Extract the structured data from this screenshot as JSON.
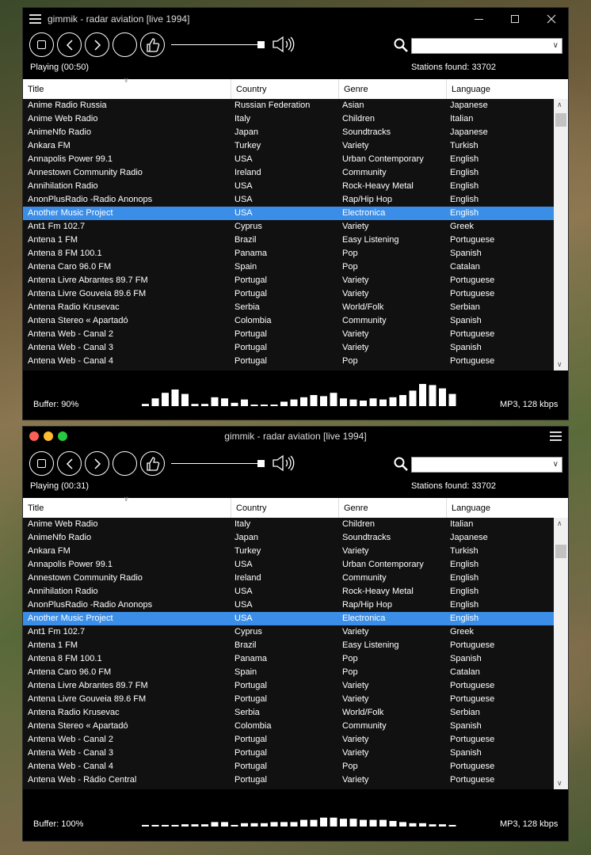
{
  "windows": [
    {
      "title": "gimmik - radar aviation [live 1994]",
      "status": "Playing (00:50)",
      "stations_found": "Stations found: 33702",
      "search_value": "",
      "columns": [
        "Title",
        "Country",
        "Genre",
        "Language"
      ],
      "rows": [
        [
          "Anime Radio Russia",
          "Russian Federation",
          "Asian",
          "Japanese"
        ],
        [
          "Anime Web Radio",
          "Italy",
          "Children",
          "Italian"
        ],
        [
          "AnimeNfo Radio",
          "Japan",
          "Soundtracks",
          "Japanese"
        ],
        [
          "Ankara FM",
          "Turkey",
          "Variety",
          "Turkish"
        ],
        [
          "Annapolis Power 99.1",
          "USA",
          "Urban Contemporary",
          "English"
        ],
        [
          "Annestown Community Radio",
          "Ireland",
          "Community",
          "English"
        ],
        [
          "Annihilation Radio",
          "USA",
          "Rock-Heavy Metal",
          "English"
        ],
        [
          "AnonPlusRadio -Radio Anonops",
          "USA",
          "Rap/Hip Hop",
          "English"
        ],
        [
          "Another Music Project",
          "USA",
          "Electronica",
          "English"
        ],
        [
          "Ant1 Fm 102.7",
          "Cyprus",
          "Variety",
          "Greek"
        ],
        [
          "Antena 1 FM",
          "Brazil",
          "Easy Listening",
          "Portuguese"
        ],
        [
          "Antena 8 FM 100.1",
          "Panama",
          "Pop",
          "Spanish"
        ],
        [
          "Antena Caro 96.0 FM",
          "Spain",
          "Pop",
          "Catalan"
        ],
        [
          "Antena Livre Abrantes 89.7 FM",
          "Portugal",
          "Variety",
          "Portuguese"
        ],
        [
          "Antena Livre Gouveia 89.6 FM",
          "Portugal",
          "Variety",
          "Portuguese"
        ],
        [
          "Antena Radio Krusevac",
          "Serbia",
          "World/Folk",
          "Serbian"
        ],
        [
          "Antena Stereo « Apartadó",
          "Colombia",
          "Community",
          "Spanish"
        ],
        [
          "Antena Web - Canal 2",
          "Portugal",
          "Variety",
          "Portuguese"
        ],
        [
          "Antena Web - Canal 3",
          "Portugal",
          "Variety",
          "Spanish"
        ],
        [
          "Antena Web - Canal 4",
          "Portugal",
          "Pop",
          "Portuguese"
        ]
      ],
      "selected_index": 8,
      "buffer": "Buffer: 90%",
      "bitrate": "MP3, 128 kbps",
      "visualizer_levels": [
        0.1,
        0.35,
        0.6,
        0.75,
        0.55,
        0.1,
        0.1,
        0.4,
        0.35,
        0.15,
        0.3,
        0.05,
        0.05,
        0.05,
        0.2,
        0.3,
        0.4,
        0.5,
        0.45,
        0.6,
        0.35,
        0.3,
        0.25,
        0.35,
        0.3,
        0.4,
        0.5,
        0.7,
        1.0,
        0.95,
        0.8,
        0.55,
        0.05
      ]
    },
    {
      "title": "gimmik - radar aviation [live 1994]",
      "status": "Playing (00:31)",
      "stations_found": "Stations found: 33702",
      "search_value": "",
      "columns": [
        "Title",
        "Country",
        "Genre",
        "Language"
      ],
      "rows": [
        [
          "Anime Web Radio",
          "Italy",
          "Children",
          "Italian"
        ],
        [
          "AnimeNfo Radio",
          "Japan",
          "Soundtracks",
          "Japanese"
        ],
        [
          "Ankara FM",
          "Turkey",
          "Variety",
          "Turkish"
        ],
        [
          "Annapolis Power 99.1",
          "USA",
          "Urban Contemporary",
          "English"
        ],
        [
          "Annestown Community Radio",
          "Ireland",
          "Community",
          "English"
        ],
        [
          "Annihilation Radio",
          "USA",
          "Rock-Heavy Metal",
          "English"
        ],
        [
          "AnonPlusRadio -Radio Anonops",
          "USA",
          "Rap/Hip Hop",
          "English"
        ],
        [
          "Another Music Project",
          "USA",
          "Electronica",
          "English"
        ],
        [
          "Ant1 Fm 102.7",
          "Cyprus",
          "Variety",
          "Greek"
        ],
        [
          "Antena 1 FM",
          "Brazil",
          "Easy Listening",
          "Portuguese"
        ],
        [
          "Antena 8 FM 100.1",
          "Panama",
          "Pop",
          "Spanish"
        ],
        [
          "Antena Caro 96.0 FM",
          "Spain",
          "Pop",
          "Catalan"
        ],
        [
          "Antena Livre Abrantes 89.7 FM",
          "Portugal",
          "Variety",
          "Portuguese"
        ],
        [
          "Antena Livre Gouveia 89.6 FM",
          "Portugal",
          "Variety",
          "Portuguese"
        ],
        [
          "Antena Radio Krusevac",
          "Serbia",
          "World/Folk",
          "Serbian"
        ],
        [
          "Antena Stereo « Apartadó",
          "Colombia",
          "Community",
          "Spanish"
        ],
        [
          "Antena Web - Canal 2",
          "Portugal",
          "Variety",
          "Portuguese"
        ],
        [
          "Antena Web - Canal 3",
          "Portugal",
          "Variety",
          "Spanish"
        ],
        [
          "Antena Web - Canal 4",
          "Portugal",
          "Pop",
          "Portuguese"
        ],
        [
          "Antena Web - Rádio Central",
          "Portugal",
          "Variety",
          "Portuguese"
        ]
      ],
      "selected_index": 7,
      "buffer": "Buffer: 100%",
      "bitrate": "MP3, 128 kbps",
      "visualizer_levels": [
        0.05,
        0.05,
        0.05,
        0.05,
        0.1,
        0.1,
        0.1,
        0.2,
        0.2,
        0.05,
        0.15,
        0.15,
        0.15,
        0.2,
        0.2,
        0.2,
        0.3,
        0.3,
        0.4,
        0.4,
        0.35,
        0.35,
        0.3,
        0.3,
        0.3,
        0.25,
        0.2,
        0.15,
        0.15,
        0.1,
        0.1,
        0.05,
        0.05
      ]
    }
  ],
  "colors": {
    "selection": "#3b8ee8",
    "window_bg": "#000000",
    "header_bg": "#ffffff"
  }
}
